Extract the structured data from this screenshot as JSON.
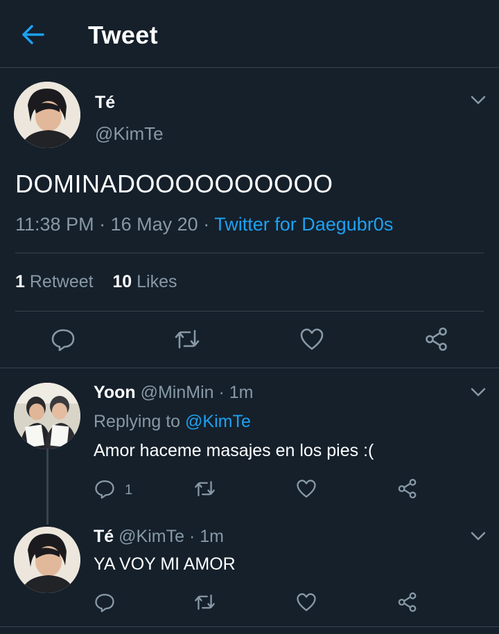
{
  "header": {
    "title": "Tweet"
  },
  "main_tweet": {
    "display_name": "Té",
    "handle": "@KimTe",
    "text": "DOMINADOOOOOOOOOO",
    "time": "11:38 PM",
    "date": "16 May 20",
    "separator": "·",
    "source": "Twitter for Daegubr0s",
    "retweet_count": "1",
    "retweet_label": "Retweet",
    "like_count": "10",
    "like_label": "Likes"
  },
  "replies": [
    {
      "display_name": "Yoon",
      "handle": "@MinMin",
      "separator": "·",
      "time": "1m",
      "replying_prefix": "Replying to",
      "replying_to": "@KimTe",
      "text": "Amor haceme masajes en los pies :(",
      "reply_count": "1"
    },
    {
      "display_name": "Té",
      "handle": "@KimTe",
      "separator": "·",
      "time": "1m",
      "text": "YA VOY MI AMOR"
    }
  ],
  "icons": [
    "back-arrow-icon",
    "chevron-down-icon",
    "reply-icon",
    "retweet-icon",
    "like-icon",
    "share-icon"
  ],
  "colors": {
    "background": "#15202b",
    "accent": "#1da1f2",
    "secondary_text": "#8899a6",
    "divider": "#38444d"
  }
}
